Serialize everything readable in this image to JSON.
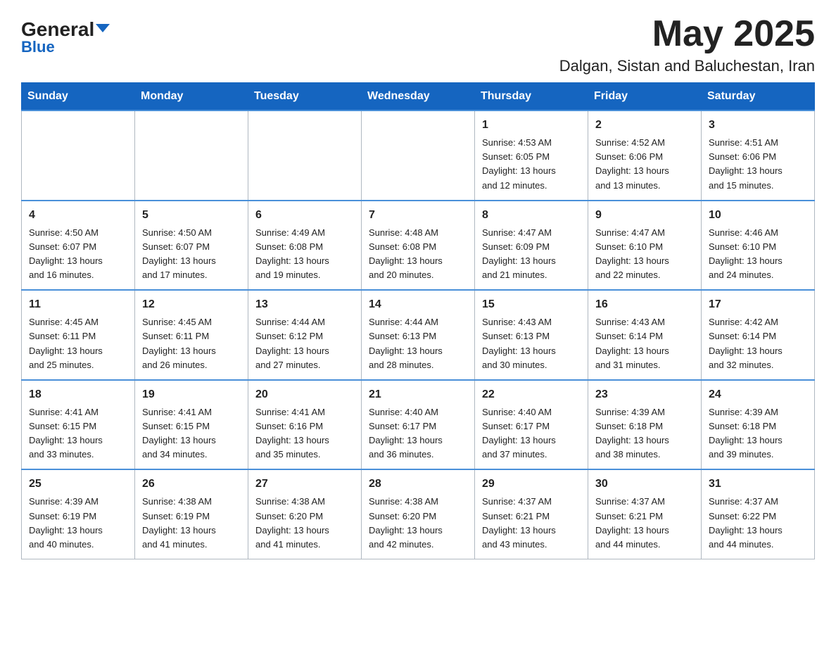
{
  "header": {
    "logo_main": "General",
    "logo_sub": "Blue",
    "month": "May 2025",
    "location": "Dalgan, Sistan and Baluchestan, Iran"
  },
  "days_of_week": [
    "Sunday",
    "Monday",
    "Tuesday",
    "Wednesday",
    "Thursday",
    "Friday",
    "Saturday"
  ],
  "weeks": [
    [
      {
        "day": "",
        "info": ""
      },
      {
        "day": "",
        "info": ""
      },
      {
        "day": "",
        "info": ""
      },
      {
        "day": "",
        "info": ""
      },
      {
        "day": "1",
        "info": "Sunrise: 4:53 AM\nSunset: 6:05 PM\nDaylight: 13 hours\nand 12 minutes."
      },
      {
        "day": "2",
        "info": "Sunrise: 4:52 AM\nSunset: 6:06 PM\nDaylight: 13 hours\nand 13 minutes."
      },
      {
        "day": "3",
        "info": "Sunrise: 4:51 AM\nSunset: 6:06 PM\nDaylight: 13 hours\nand 15 minutes."
      }
    ],
    [
      {
        "day": "4",
        "info": "Sunrise: 4:50 AM\nSunset: 6:07 PM\nDaylight: 13 hours\nand 16 minutes."
      },
      {
        "day": "5",
        "info": "Sunrise: 4:50 AM\nSunset: 6:07 PM\nDaylight: 13 hours\nand 17 minutes."
      },
      {
        "day": "6",
        "info": "Sunrise: 4:49 AM\nSunset: 6:08 PM\nDaylight: 13 hours\nand 19 minutes."
      },
      {
        "day": "7",
        "info": "Sunrise: 4:48 AM\nSunset: 6:08 PM\nDaylight: 13 hours\nand 20 minutes."
      },
      {
        "day": "8",
        "info": "Sunrise: 4:47 AM\nSunset: 6:09 PM\nDaylight: 13 hours\nand 21 minutes."
      },
      {
        "day": "9",
        "info": "Sunrise: 4:47 AM\nSunset: 6:10 PM\nDaylight: 13 hours\nand 22 minutes."
      },
      {
        "day": "10",
        "info": "Sunrise: 4:46 AM\nSunset: 6:10 PM\nDaylight: 13 hours\nand 24 minutes."
      }
    ],
    [
      {
        "day": "11",
        "info": "Sunrise: 4:45 AM\nSunset: 6:11 PM\nDaylight: 13 hours\nand 25 minutes."
      },
      {
        "day": "12",
        "info": "Sunrise: 4:45 AM\nSunset: 6:11 PM\nDaylight: 13 hours\nand 26 minutes."
      },
      {
        "day": "13",
        "info": "Sunrise: 4:44 AM\nSunset: 6:12 PM\nDaylight: 13 hours\nand 27 minutes."
      },
      {
        "day": "14",
        "info": "Sunrise: 4:44 AM\nSunset: 6:13 PM\nDaylight: 13 hours\nand 28 minutes."
      },
      {
        "day": "15",
        "info": "Sunrise: 4:43 AM\nSunset: 6:13 PM\nDaylight: 13 hours\nand 30 minutes."
      },
      {
        "day": "16",
        "info": "Sunrise: 4:43 AM\nSunset: 6:14 PM\nDaylight: 13 hours\nand 31 minutes."
      },
      {
        "day": "17",
        "info": "Sunrise: 4:42 AM\nSunset: 6:14 PM\nDaylight: 13 hours\nand 32 minutes."
      }
    ],
    [
      {
        "day": "18",
        "info": "Sunrise: 4:41 AM\nSunset: 6:15 PM\nDaylight: 13 hours\nand 33 minutes."
      },
      {
        "day": "19",
        "info": "Sunrise: 4:41 AM\nSunset: 6:15 PM\nDaylight: 13 hours\nand 34 minutes."
      },
      {
        "day": "20",
        "info": "Sunrise: 4:41 AM\nSunset: 6:16 PM\nDaylight: 13 hours\nand 35 minutes."
      },
      {
        "day": "21",
        "info": "Sunrise: 4:40 AM\nSunset: 6:17 PM\nDaylight: 13 hours\nand 36 minutes."
      },
      {
        "day": "22",
        "info": "Sunrise: 4:40 AM\nSunset: 6:17 PM\nDaylight: 13 hours\nand 37 minutes."
      },
      {
        "day": "23",
        "info": "Sunrise: 4:39 AM\nSunset: 6:18 PM\nDaylight: 13 hours\nand 38 minutes."
      },
      {
        "day": "24",
        "info": "Sunrise: 4:39 AM\nSunset: 6:18 PM\nDaylight: 13 hours\nand 39 minutes."
      }
    ],
    [
      {
        "day": "25",
        "info": "Sunrise: 4:39 AM\nSunset: 6:19 PM\nDaylight: 13 hours\nand 40 minutes."
      },
      {
        "day": "26",
        "info": "Sunrise: 4:38 AM\nSunset: 6:19 PM\nDaylight: 13 hours\nand 41 minutes."
      },
      {
        "day": "27",
        "info": "Sunrise: 4:38 AM\nSunset: 6:20 PM\nDaylight: 13 hours\nand 41 minutes."
      },
      {
        "day": "28",
        "info": "Sunrise: 4:38 AM\nSunset: 6:20 PM\nDaylight: 13 hours\nand 42 minutes."
      },
      {
        "day": "29",
        "info": "Sunrise: 4:37 AM\nSunset: 6:21 PM\nDaylight: 13 hours\nand 43 minutes."
      },
      {
        "day": "30",
        "info": "Sunrise: 4:37 AM\nSunset: 6:21 PM\nDaylight: 13 hours\nand 44 minutes."
      },
      {
        "day": "31",
        "info": "Sunrise: 4:37 AM\nSunset: 6:22 PM\nDaylight: 13 hours\nand 44 minutes."
      }
    ]
  ]
}
